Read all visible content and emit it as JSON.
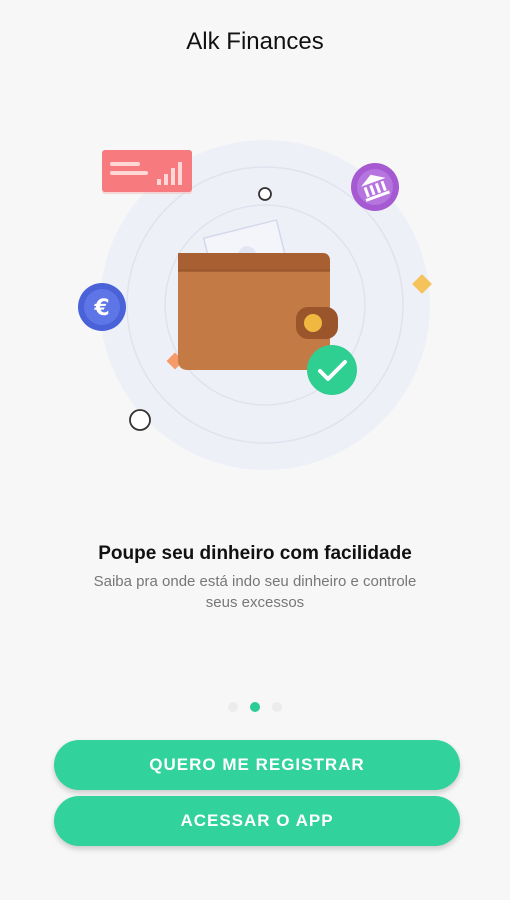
{
  "app": {
    "title": "Alk Finances"
  },
  "onboarding": {
    "headline": "Poupe seu dinheiro com facilidade",
    "subtitle": "Saiba pra onde está indo seu dinheiro e controle seus excessos",
    "page_indicator": {
      "total": 3,
      "active": 2
    }
  },
  "buttons": {
    "register_label": "QUERO ME REGISTRAR",
    "access_label": "ACESSAR O APP"
  },
  "colors": {
    "accent": "#31d29b",
    "wallet": "#c37a44",
    "card": "#f77b7e",
    "euro_coin": "#4a62d8",
    "bank_coin": "#a55ad2",
    "check": "#2fcf91"
  },
  "icons": [
    "wallet-icon",
    "card-icon",
    "euro-coin-icon",
    "bank-coin-icon",
    "checkmark-icon"
  ]
}
